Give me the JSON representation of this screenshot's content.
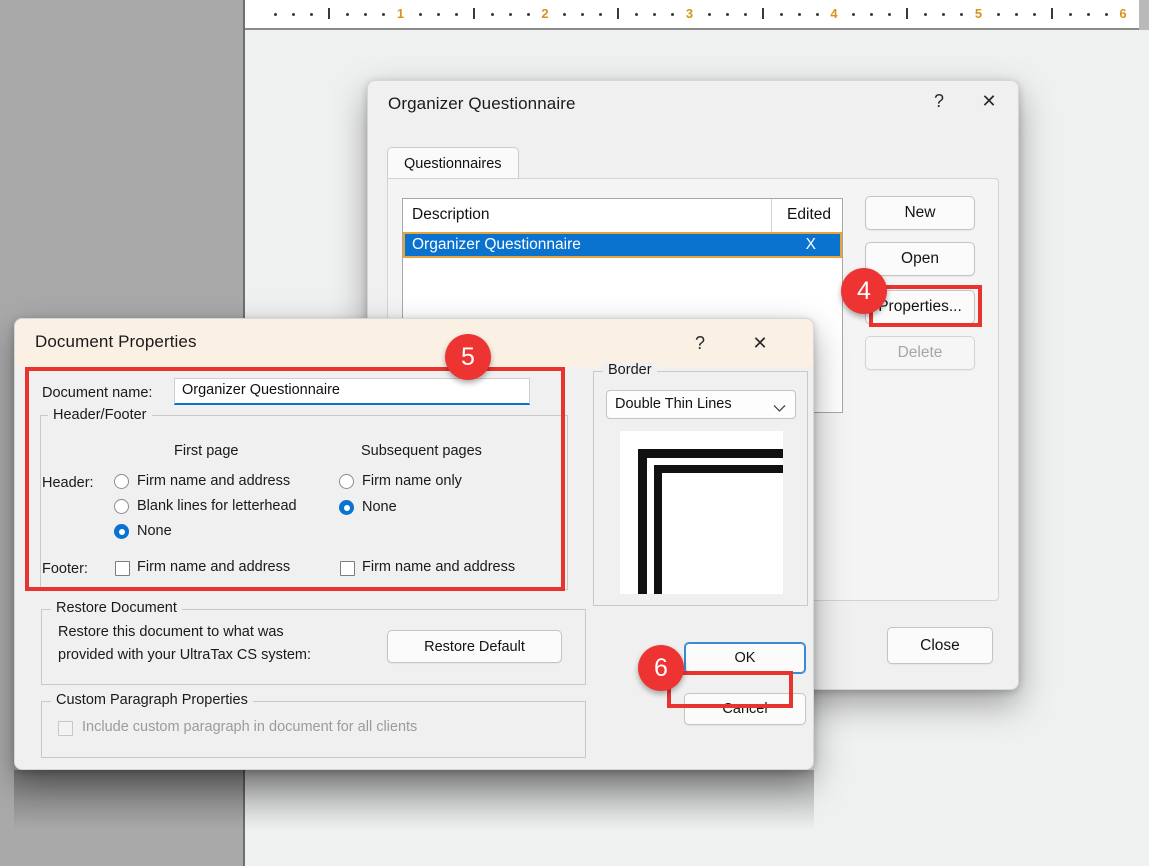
{
  "ruler": {
    "unit_labels": [
      "1",
      "2",
      "3",
      "4",
      "5",
      "6"
    ],
    "number_color": "#d9931f"
  },
  "questionnaire_dialog": {
    "title": "Organizer Questionnaire",
    "help_glyph": "?",
    "close_glyph": "✕",
    "tab_label": "Questionnaires",
    "list": {
      "columns": [
        "Description",
        "Edited"
      ],
      "rows": [
        {
          "description": "Organizer Questionnaire",
          "edited": "X",
          "selected": true
        }
      ],
      "selection_fill": "#0a72cf",
      "selection_border": "#e8a33d"
    },
    "buttons": {
      "new": "New",
      "open": "Open",
      "properties": "Properties...",
      "delete": "Delete",
      "close": "Close"
    }
  },
  "document_properties_dialog": {
    "title": "Document Properties",
    "help_glyph": "?",
    "close_glyph": "✕",
    "document_name_label": "Document name:",
    "document_name_value": "Organizer Questionnaire",
    "header_footer": {
      "legend": "Header/Footer",
      "col_first_page": "First page",
      "col_subsequent_pages": "Subsequent pages",
      "header_label": "Header:",
      "footer_label": "Footer:",
      "first_page_header_options": [
        {
          "label": "Firm name and address",
          "selected": false
        },
        {
          "label": "Blank lines for letterhead",
          "selected": false
        },
        {
          "label": "None",
          "selected": true
        }
      ],
      "subsequent_header_options": [
        {
          "label": "Firm name only",
          "selected": false
        },
        {
          "label": "None",
          "selected": true
        }
      ],
      "first_page_footer": {
        "label": "Firm name and address",
        "checked": false
      },
      "subsequent_footer": {
        "label": "Firm name and address",
        "checked": false
      }
    },
    "border": {
      "legend": "Border",
      "selected_style": "Double Thin Lines",
      "chevron": "chevron-down-icon"
    },
    "restore": {
      "legend": "Restore Document",
      "text_line1": "Restore this document to what was",
      "text_line2": "provided with your UltraTax CS system:",
      "button": "Restore Default"
    },
    "custom_paragraph": {
      "legend": "Custom Paragraph Properties",
      "checkbox_label": "Include custom paragraph in document for all clients",
      "checked": false,
      "disabled": true
    },
    "buttons": {
      "ok": "OK",
      "cancel": "Cancel"
    }
  },
  "annotations": {
    "badges": [
      {
        "number": "4",
        "target": "properties-button"
      },
      {
        "number": "5",
        "target": "header-footer-section"
      },
      {
        "number": "6",
        "target": "ok-button"
      }
    ],
    "highlight_color": "#e8332f"
  }
}
